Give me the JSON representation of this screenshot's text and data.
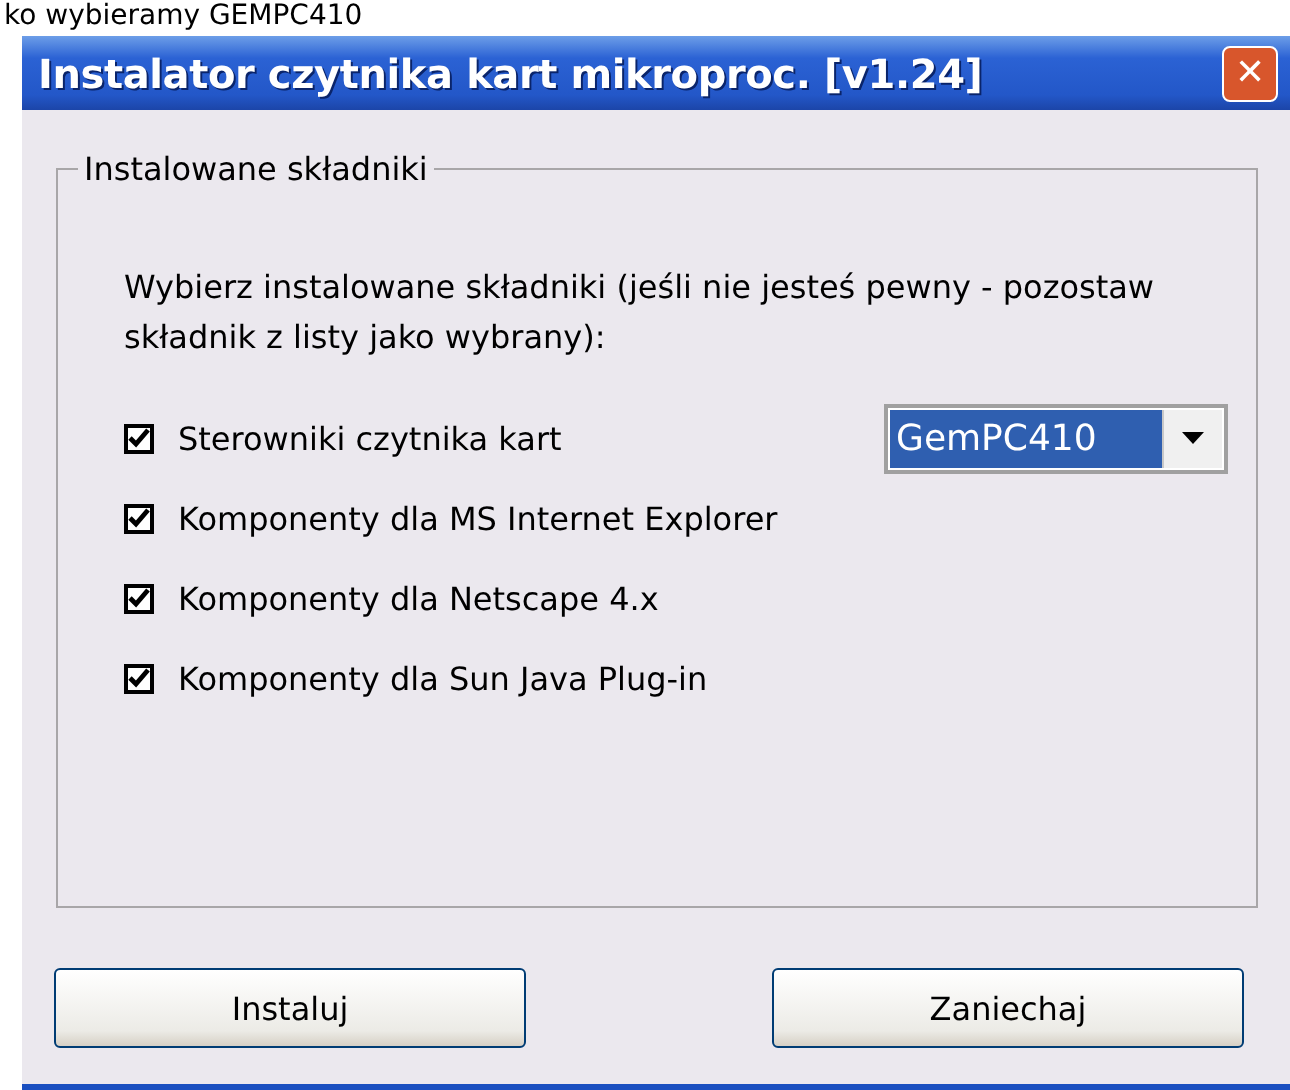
{
  "caption": "ko wybieramy GEMPC410",
  "window": {
    "title": "Instalator czytnika kart mikroproc. [v1.24]",
    "close": "✕"
  },
  "group": {
    "title": "Instalowane składniki",
    "description": "Wybierz instalowane składniki (jeśli nie jesteś pewny - pozostaw składnik z listy jako wybrany):",
    "components": [
      {
        "label": "Sterowniki czytnika kart",
        "checked": true,
        "dropdown": {
          "value": "GemPC410"
        }
      },
      {
        "label": "Komponenty dla MS Internet Explorer",
        "checked": true
      },
      {
        "label": "Komponenty dla Netscape 4.x",
        "checked": true
      },
      {
        "label": "Komponenty dla Sun Java Plug-in",
        "checked": true
      }
    ]
  },
  "buttons": [
    "Instaluj",
    "Zaniechaj"
  ]
}
